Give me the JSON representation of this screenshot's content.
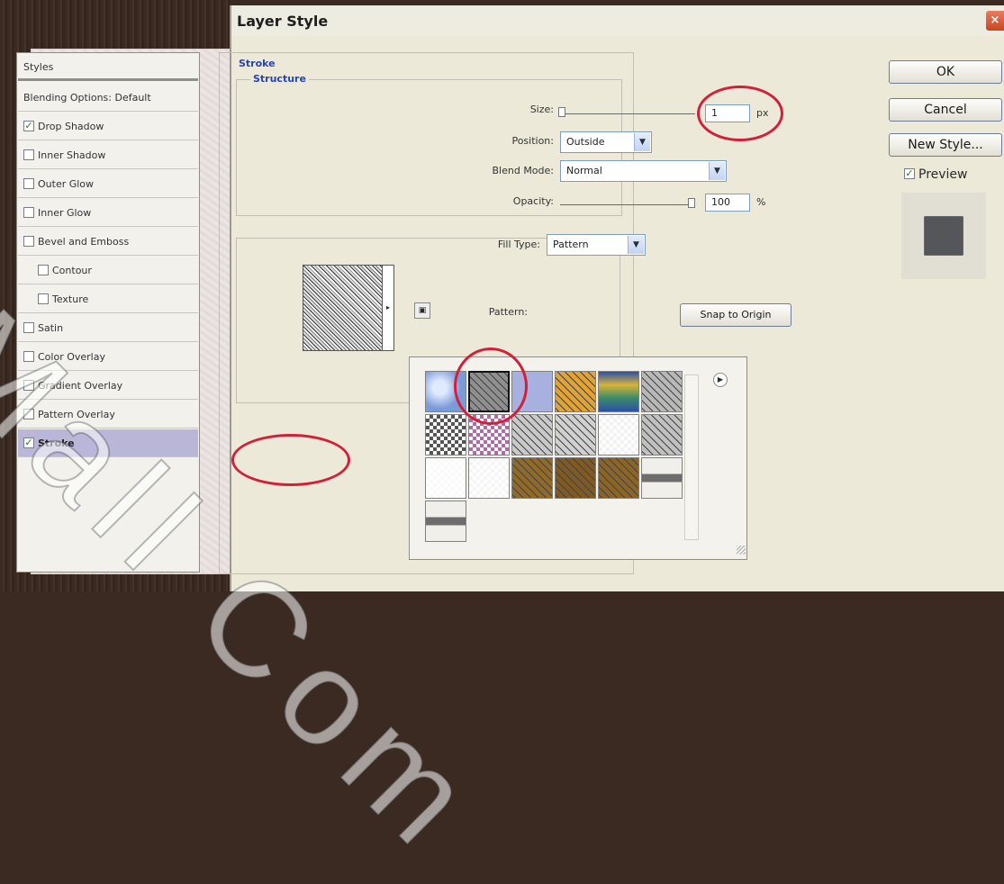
{
  "dialog": {
    "title": "Layer Style",
    "close_label": "×"
  },
  "styles_list": {
    "header": "Styles",
    "items": [
      {
        "label": "Blending Options: Default",
        "has_checkbox": false,
        "checked": false
      },
      {
        "label": "Drop Shadow",
        "has_checkbox": true,
        "checked": true
      },
      {
        "label": "Inner Shadow",
        "has_checkbox": true,
        "checked": false
      },
      {
        "label": "Outer Glow",
        "has_checkbox": true,
        "checked": false
      },
      {
        "label": "Inner Glow",
        "has_checkbox": true,
        "checked": false
      },
      {
        "label": "Bevel and Emboss",
        "has_checkbox": true,
        "checked": false
      },
      {
        "label": "Contour",
        "has_checkbox": true,
        "checked": false
      },
      {
        "label": "Texture",
        "has_checkbox": true,
        "checked": false
      },
      {
        "label": "Satin",
        "has_checkbox": true,
        "checked": false
      },
      {
        "label": "Color Overlay",
        "has_checkbox": true,
        "checked": false
      },
      {
        "label": "Gradient Overlay",
        "has_checkbox": true,
        "checked": false
      },
      {
        "label": "Pattern Overlay",
        "has_checkbox": true,
        "checked": false
      },
      {
        "label": "Stroke",
        "has_checkbox": true,
        "checked": true,
        "selected": true
      }
    ]
  },
  "stroke": {
    "section_title": "Stroke",
    "structure_title": "Structure",
    "size": {
      "label": "Size:",
      "value": "1",
      "unit": "px",
      "slider_fraction": 0.0
    },
    "position": {
      "label": "Position:",
      "value": "Outside"
    },
    "blend_mode": {
      "label": "Blend Mode:",
      "value": "Normal"
    },
    "opacity": {
      "label": "Opacity:",
      "value": "100",
      "unit": "%",
      "slider_fraction": 1.0
    },
    "fill_type": {
      "label": "Fill Type:",
      "value": "Pattern"
    },
    "pattern": {
      "label": "Pattern:"
    },
    "snap_button": "Snap to Origin"
  },
  "buttons": {
    "ok": "OK",
    "cancel": "Cancel",
    "new_style": "New Style..."
  },
  "preview": {
    "label": "Preview",
    "checked": true
  },
  "pattern_swatches": [
    {
      "name": "bubbles",
      "color": "#7b9ad8"
    },
    {
      "name": "gray-granite",
      "color": "#8f8f8f",
      "selected": true
    },
    {
      "name": "periwinkle",
      "color": "#a8b0e0"
    },
    {
      "name": "orange-texture",
      "color": "#e0a33a"
    },
    {
      "name": "tie-dye",
      "color": "#5f9fa0"
    },
    {
      "name": "stone-gray",
      "color": "#b8b8b8"
    },
    {
      "name": "checker",
      "color": "#555555"
    },
    {
      "name": "multicolor-dots",
      "color": "#b06aa8"
    },
    {
      "name": "gray-paper",
      "color": "#c9c9c9"
    },
    {
      "name": "gray-fibers",
      "color": "#d0d0d0"
    },
    {
      "name": "stripe-line",
      "color": "#f2f2f2"
    },
    {
      "name": "gray-marble",
      "color": "#c0c0c0"
    },
    {
      "name": "dots-sparse",
      "color": "#fafafa"
    },
    {
      "name": "dots-dense",
      "color": "#f5f5f5"
    },
    {
      "name": "brown-texture-1",
      "color": "#8f6a2a"
    },
    {
      "name": "brown-texture-2",
      "color": "#7f5a24"
    },
    {
      "name": "brown-texture-3",
      "color": "#8a6527"
    },
    {
      "name": "brown-band",
      "color": "#f1efea"
    },
    {
      "name": "dark-band",
      "color": "#f1efea"
    }
  ],
  "watermark": {
    "text": "Mall Com"
  },
  "colors": {
    "accent_blue": "#2645b0",
    "annotation_red": "#d3203a",
    "selected_row": "#b9b6d8"
  }
}
